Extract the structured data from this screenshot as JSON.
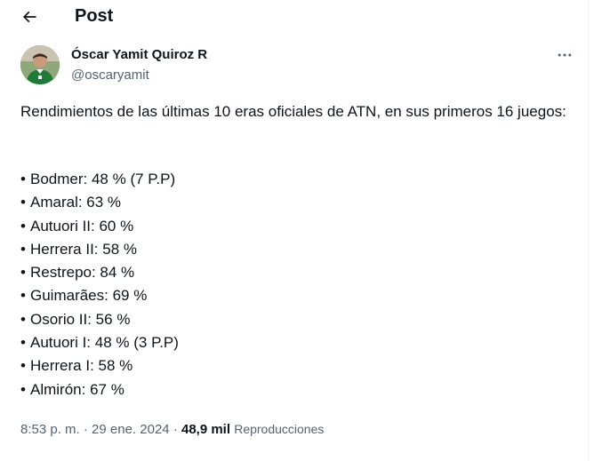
{
  "header": {
    "title": "Post"
  },
  "author": {
    "name": "Óscar Yamit Quiroz R",
    "handle": "@oscaryamit"
  },
  "tweet": {
    "intro": "Rendimientos de las últimas 10 eras oficiales de ATN, en sus primeros 16 juegos:",
    "bullet": "•",
    "items": [
      "Bodmer: 48 % (7 P.P)",
      "Amaral: 63 %",
      "Autuori II: 60 %",
      "Herrera II: 58 %",
      "Restrepo: 84 %",
      "Guimarães: 69 %",
      "Osorio II: 56 %",
      "Autuori I: 48 % (3 P.P)",
      "Herrera I: 58 %",
      "Almirón: 67 %"
    ]
  },
  "meta": {
    "time": "8:53 p. m.",
    "separator": "·",
    "date": "29 ene. 2024",
    "views_count": "48,9 mil",
    "views_label": "Reproducciones"
  },
  "colors": {
    "text": "#0f1419",
    "secondary": "#536471",
    "border": "#eff3f4"
  },
  "icons": {
    "back": "arrow-left-icon",
    "more": "more-horizontal-icon"
  }
}
